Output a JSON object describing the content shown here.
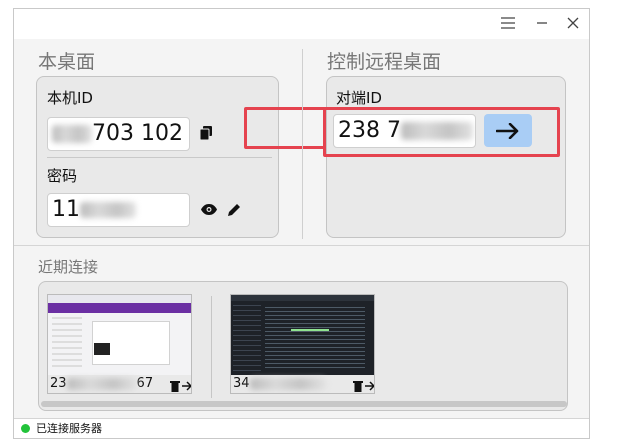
{
  "window": {
    "menu_icon": "hamburger-icon",
    "minimize_icon": "minimize-icon",
    "close_icon": "close-icon"
  },
  "local": {
    "section_title": "本桌面",
    "id_label": "本机ID",
    "id_value_visible": "703 102",
    "copy_icon": "copy-icon",
    "password_label": "密码",
    "password_value_visible": "11",
    "show_icon": "eye-icon",
    "edit_icon": "pencil-icon"
  },
  "remote": {
    "section_title": "控制远程桌面",
    "id_label": "对端ID",
    "id_value_visible": "238 7",
    "connect_icon": "arrow-right-icon"
  },
  "recent": {
    "section_title": "近期连接",
    "items": [
      {
        "id_prefix": "23",
        "id_suffix": "67",
        "delete_icon": "trash-icon",
        "connect_icon": "arrow-right-icon"
      },
      {
        "id_prefix": "34",
        "id_suffix": "",
        "delete_icon": "trash-icon",
        "connect_icon": "arrow-right-icon"
      }
    ]
  },
  "status": {
    "text": "已连接服务器",
    "color": "#22c33a"
  },
  "colors": {
    "highlight": "#e5434f",
    "button": "#a9cdf5"
  }
}
